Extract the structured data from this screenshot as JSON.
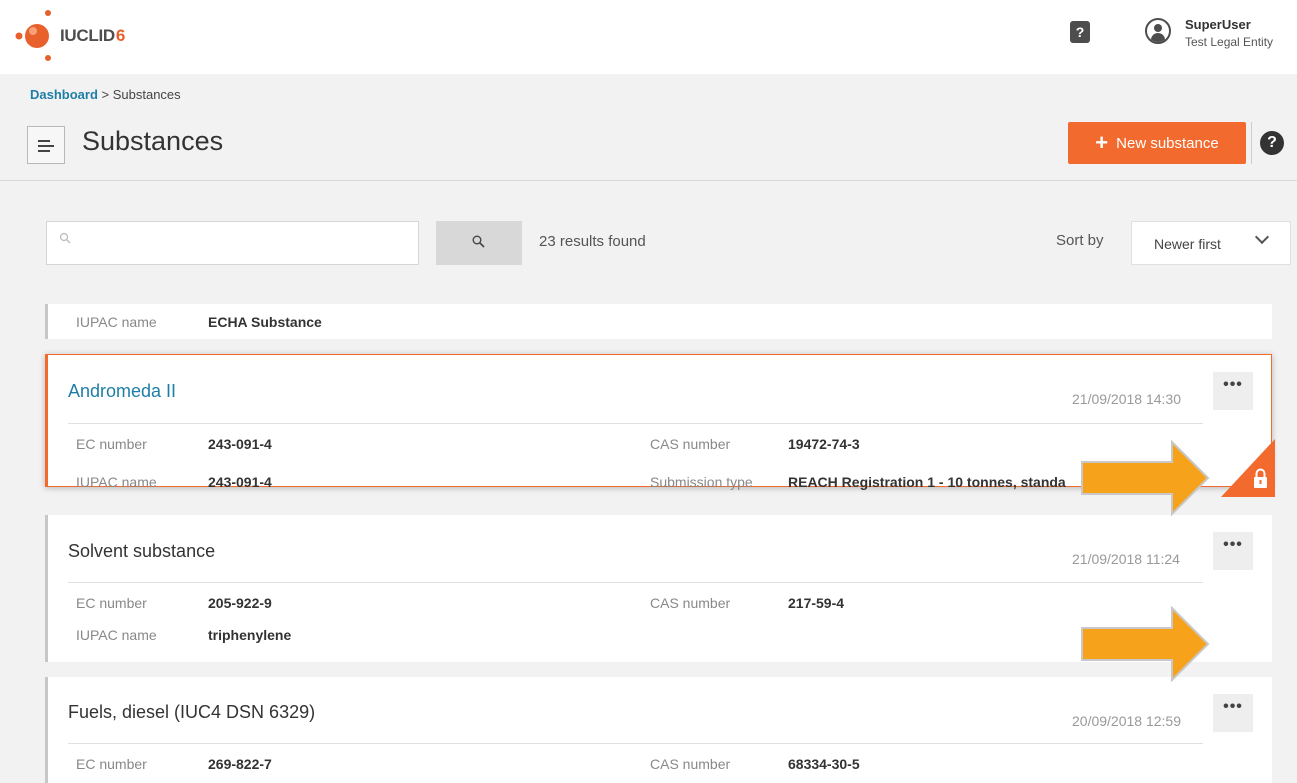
{
  "app": {
    "logo_text": "IUCLID",
    "logo_version": "6"
  },
  "header": {
    "help_icon": "question-doc-icon",
    "user_icon": "user-circle-icon",
    "user_name": "SuperUser",
    "user_entity": "Test Legal Entity"
  },
  "breadcrumb": {
    "root": "Dashboard",
    "separator": " > ",
    "current": "Substances"
  },
  "page": {
    "title": "Substances",
    "new_button": "New substance",
    "new_button_icon": "plus-icon",
    "help_icon": "question-circle-icon"
  },
  "search": {
    "placeholder": "",
    "value": "",
    "results": "23 results found",
    "sort_label": "Sort by",
    "sort_value": "Newer first"
  },
  "colors": {
    "accent": "#f26a2e",
    "link": "#1f7ea5",
    "annotation_arrow": "#f7a21b"
  },
  "cards": [
    {
      "iupac_label": "IUPAC name",
      "iupac_value": "ECHA Substance"
    },
    {
      "title": "Andromeda II",
      "date": "21/09/2018 14:30",
      "menu": "•••",
      "ec_label": "EC number",
      "ec_value": "243-091-4",
      "cas_label": "CAS number",
      "cas_value": "19472-74-3",
      "iupac_label": "IUPAC name",
      "iupac_value": "243-091-4",
      "submission_label": "Submission type",
      "submission_value": "REACH Registration 1 - 10 tonnes, standa",
      "locked": true
    },
    {
      "title": "Solvent substance",
      "date": "21/09/2018 11:24",
      "menu": "•••",
      "ec_label": "EC number",
      "ec_value": "205-922-9",
      "cas_label": "CAS number",
      "cas_value": "217-59-4",
      "iupac_label": "IUPAC name",
      "iupac_value": "triphenylene"
    },
    {
      "title": "Fuels, diesel (IUC4 DSN 6329)",
      "date": "20/09/2018 12:59",
      "menu": "•••",
      "ec_label": "EC number",
      "ec_value": "269-822-7",
      "cas_label": "CAS number",
      "cas_value": "68334-30-5"
    }
  ]
}
